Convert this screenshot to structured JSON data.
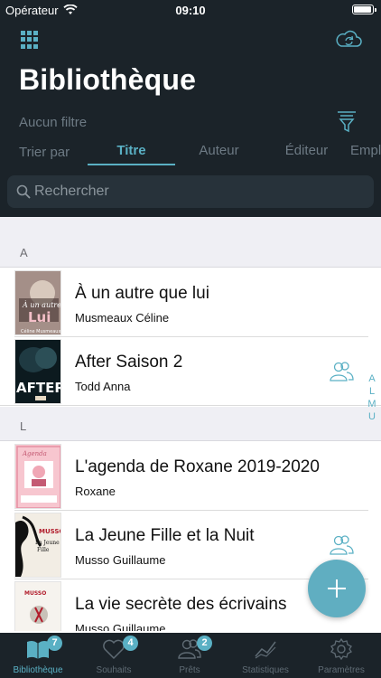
{
  "status": {
    "carrier": "Opérateur",
    "time": "09:10"
  },
  "header": {
    "title": "Bibliothèque",
    "filter": "Aucun filtre",
    "sort_label": "Trier par",
    "sort_tabs": [
      "Titre",
      "Auteur",
      "Éditeur",
      "Empl"
    ],
    "active_sort": "Titre",
    "search_placeholder": "Rechercher"
  },
  "sections": [
    {
      "letter": "A",
      "books": [
        {
          "title": "À un autre que lui",
          "author": "Musmeaux Céline",
          "lent": false
        },
        {
          "title": "After Saison 2",
          "author": "Todd Anna",
          "lent": true
        }
      ]
    },
    {
      "letter": "L",
      "books": [
        {
          "title": "L'agenda de Roxane 2019-2020",
          "author": "Roxane",
          "lent": false
        },
        {
          "title": "La Jeune Fille et la Nuit",
          "author": "Musso Guillaume",
          "lent": true
        },
        {
          "title": "La vie secrète des écrivains",
          "author": "Musso Guillaume",
          "lent": false
        }
      ]
    }
  ],
  "index_letters": [
    "A",
    "L",
    "M",
    "U"
  ],
  "tabbar": [
    {
      "label": "Bibliothèque",
      "badge": "7",
      "icon": "book-icon",
      "active": true
    },
    {
      "label": "Souhaits",
      "badge": "4",
      "icon": "heart-icon",
      "active": false
    },
    {
      "label": "Prêts",
      "badge": "2",
      "icon": "people-icon",
      "active": false
    },
    {
      "label": "Statistiques",
      "badge": "",
      "icon": "chart-icon",
      "active": false
    },
    {
      "label": "Paramètres",
      "badge": "",
      "icon": "gear-icon",
      "active": false
    }
  ],
  "colors": {
    "accent": "#5ab0c4",
    "header_bg": "#1b2329",
    "fab": "#60aec1"
  }
}
